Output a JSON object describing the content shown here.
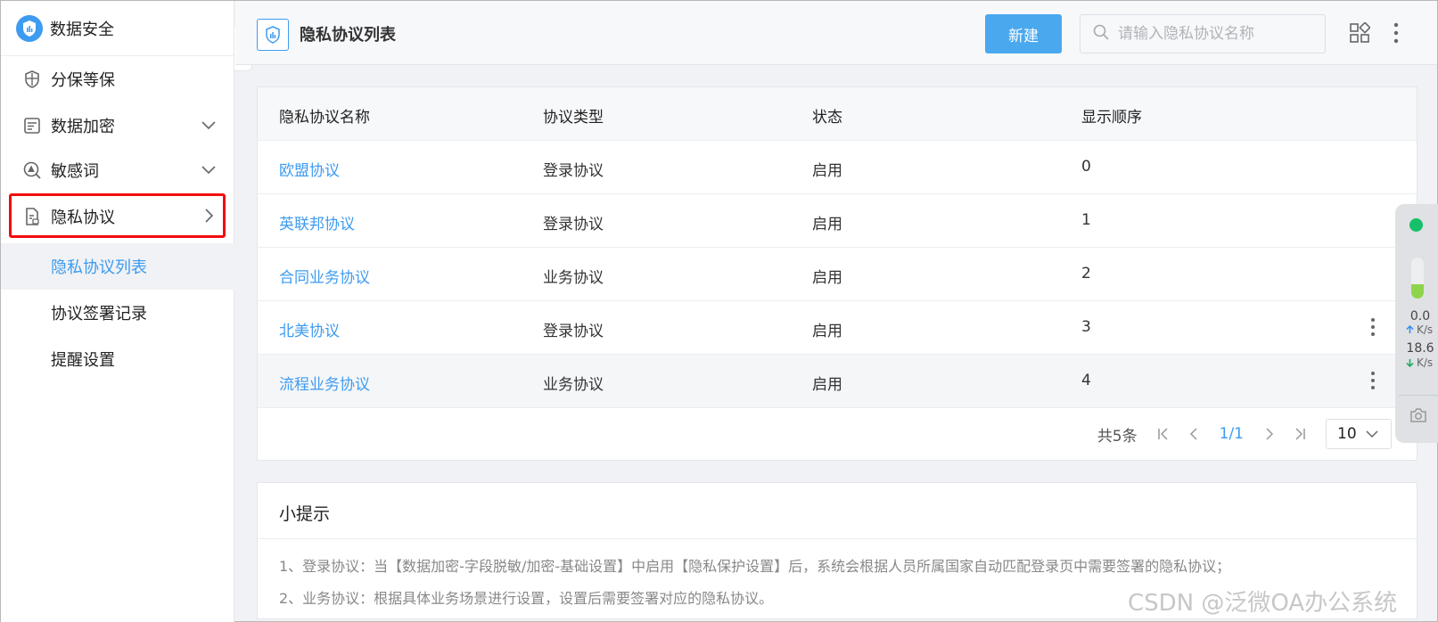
{
  "sidebar": {
    "app_title": "数据安全",
    "items": [
      {
        "label": "分保等保"
      },
      {
        "label": "数据加密"
      },
      {
        "label": "敏感词"
      },
      {
        "label": "隐私协议"
      }
    ],
    "sub_items": [
      {
        "label": "隐私协议列表"
      },
      {
        "label": "协议签署记录"
      },
      {
        "label": "提醒设置"
      }
    ]
  },
  "header": {
    "title": "隐私协议列表",
    "new_button": "新建",
    "search_placeholder": "请输入隐私协议名称"
  },
  "table": {
    "columns": [
      "隐私协议名称",
      "协议类型",
      "状态",
      "显示顺序"
    ],
    "rows": [
      {
        "name": "欧盟协议",
        "type": "登录协议",
        "status": "启用",
        "order": "0"
      },
      {
        "name": "英联邦协议",
        "type": "登录协议",
        "status": "启用",
        "order": "1"
      },
      {
        "name": "合同业务协议",
        "type": "业务协议",
        "status": "启用",
        "order": "2"
      },
      {
        "name": "北美协议",
        "type": "登录协议",
        "status": "启用",
        "order": "3"
      },
      {
        "name": "流程业务协议",
        "type": "业务协议",
        "status": "启用",
        "order": "4"
      }
    ]
  },
  "pagination": {
    "total": "共5条",
    "current": "1/1",
    "page_size": "10"
  },
  "tips": {
    "title": "小提示",
    "lines": [
      "1、登录协议：当【数据加密-字段脱敏/加密-基础设置】中启用【隐私保护设置】后，系统会根据人员所属国家自动匹配登录页中需要签署的隐私协议；",
      "2、业务协议：根据具体业务场景进行设置，设置后需要签署对应的隐私协议。"
    ]
  },
  "widget": {
    "upload_value": "0.0",
    "upload_unit": "K/s",
    "download_value": "18.6",
    "download_unit": "K/s",
    "gauge_fraction": 0.35
  },
  "watermark": "CSDN @泛微OA办公系统",
  "colors": {
    "accent": "#3d9bf0",
    "button": "#4aa8ee",
    "highlight": "#f20c0c",
    "status_green": "#16c06b"
  }
}
